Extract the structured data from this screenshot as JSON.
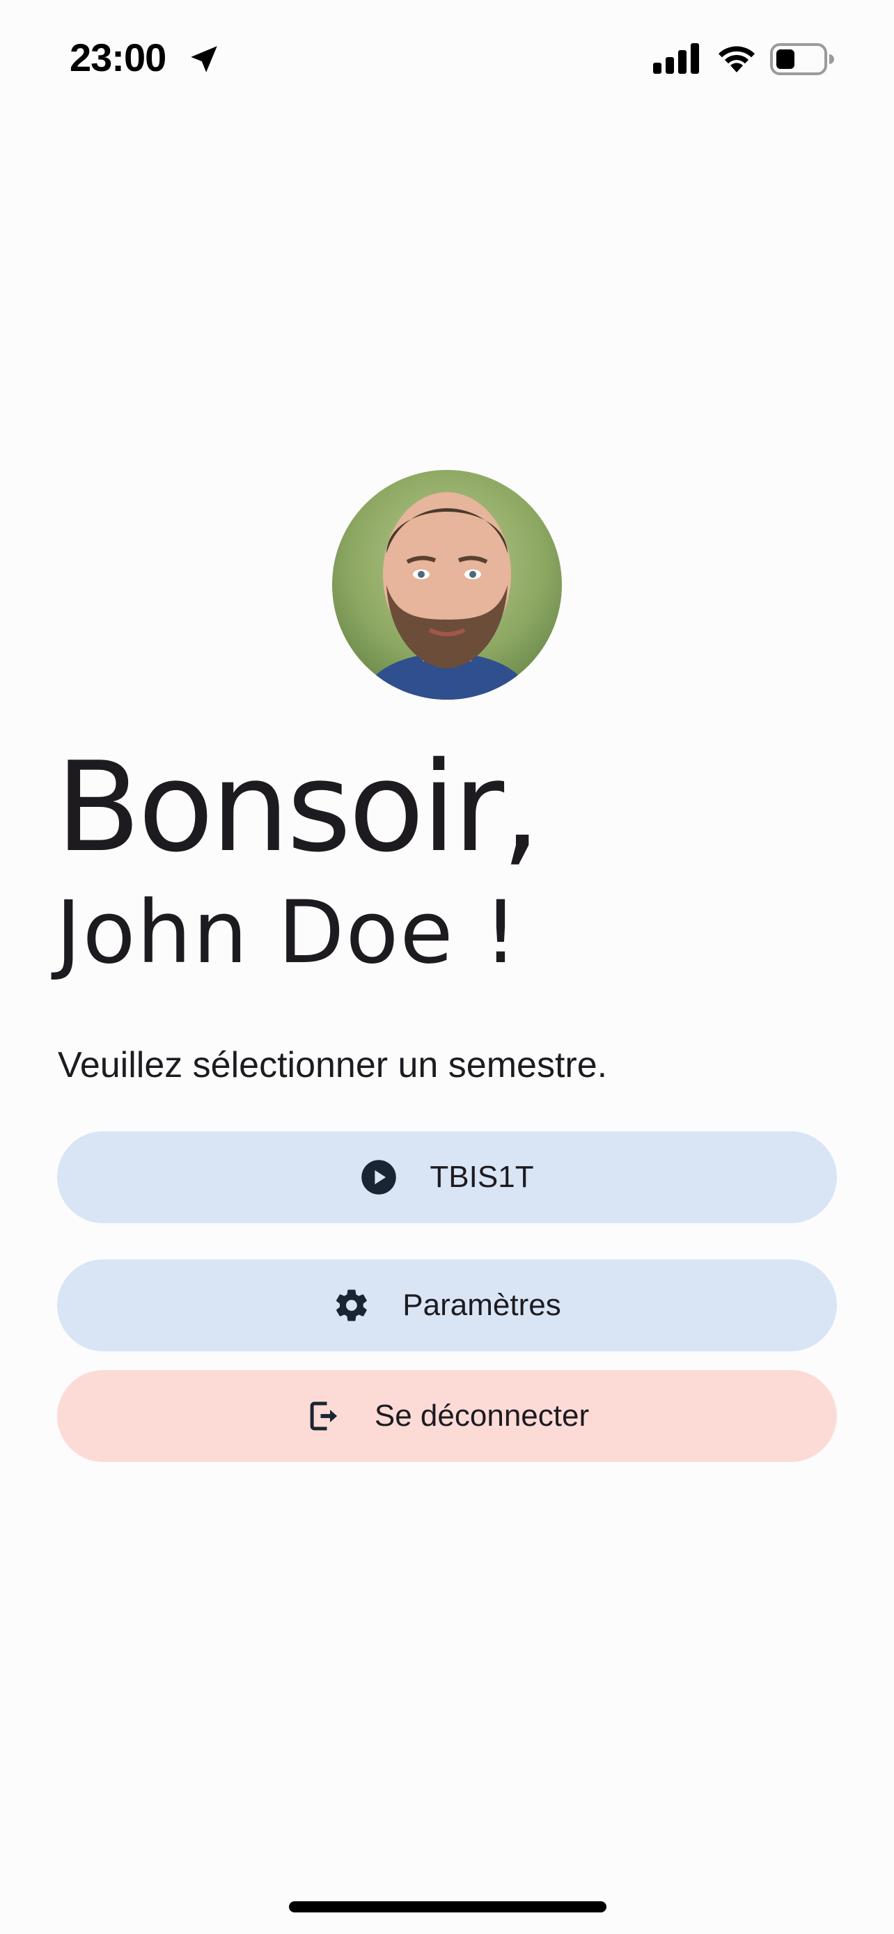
{
  "status_bar": {
    "time": "23:00",
    "icons": [
      "location-arrow-icon",
      "cellular-signal-icon",
      "wifi-icon",
      "battery-icon"
    ]
  },
  "profile": {
    "avatar": "user-avatar-photo"
  },
  "greeting": {
    "salutation": "Bonsoir,",
    "user_name": "John Doe !"
  },
  "prompt": "Veuillez sélectionner un semestre.",
  "buttons": {
    "semester": {
      "label": "TBIS1T",
      "icon": "play-circle-icon"
    },
    "settings": {
      "label": "Paramètres",
      "icon": "gear-icon"
    },
    "logout": {
      "label": "Se déconnecter",
      "icon": "logout-icon"
    }
  },
  "colors": {
    "background": "#fdfcfd",
    "primary_button": "#d9e5f5",
    "danger_button": "#fcdbd7",
    "text": "#1d1b20"
  }
}
